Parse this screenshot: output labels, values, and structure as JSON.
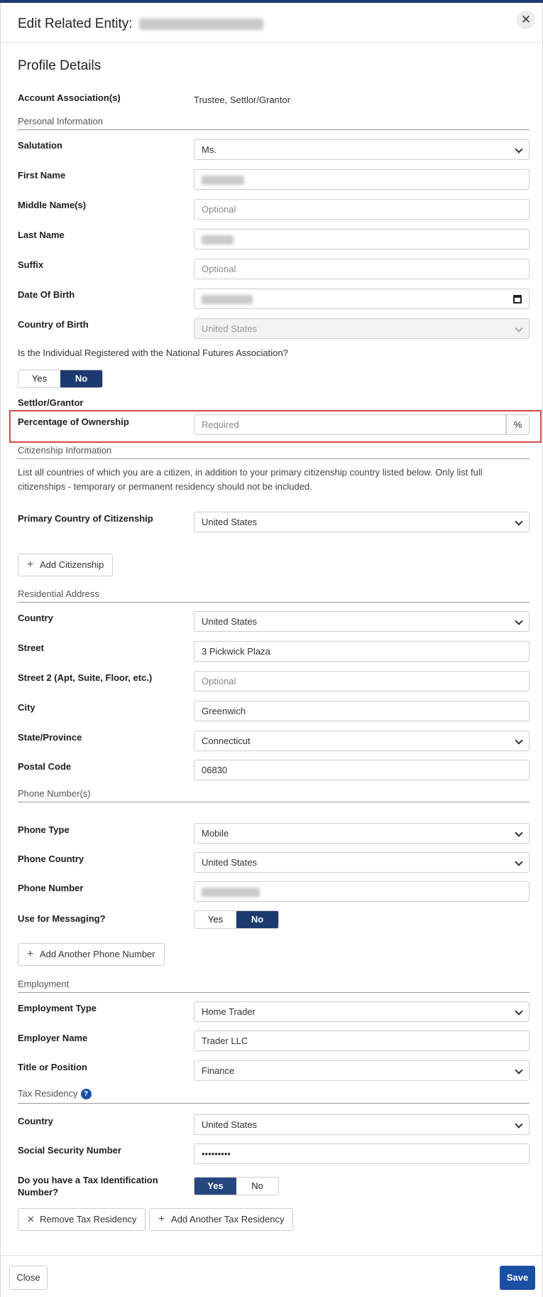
{
  "header": {
    "title": "Edit Related Entity:"
  },
  "profile": {
    "title": "Profile Details",
    "account_label": "Account Association(s)",
    "account_value": "Trustee, Settlor/Grantor"
  },
  "personal": {
    "section": "Personal Information",
    "salutation_label": "Salutation",
    "salutation_value": "Ms.",
    "first_name_label": "First Name",
    "middle_label": "Middle Name(s)",
    "middle_placeholder": "Optional",
    "last_name_label": "Last Name",
    "suffix_label": "Suffix",
    "suffix_placeholder": "Optional",
    "dob_label": "Date Of Birth",
    "cob_label": "Country of Birth",
    "cob_value": "United States",
    "nfa_question": "Is the Individual Registered with the National Futures Association?",
    "nfa_yes": "Yes",
    "nfa_no": "No"
  },
  "settlor": {
    "section": "Settlor/Grantor",
    "ownership_label": "Percentage of Ownership",
    "ownership_placeholder": "Required",
    "ownership_unit": "%"
  },
  "citizenship": {
    "section": "Citizenship Information",
    "note": "List all countries of which you are a citizen, in addition to your primary citizenship country listed below. Only list full citizenships - temporary or permanent residency should not be included.",
    "primary_label": "Primary Country of Citizenship",
    "primary_value": "United States",
    "add_button": "Add Citizenship"
  },
  "address": {
    "section": "Residential Address",
    "country_label": "Country",
    "country_value": "United States",
    "street_label": "Street",
    "street_value": "3 Pickwick Plaza",
    "street2_label": "Street 2 (Apt, Suite, Floor, etc.)",
    "street2_placeholder": "Optional",
    "city_label": "City",
    "city_value": "Greenwich",
    "state_label": "State/Province",
    "state_value": "Connecticut",
    "postal_label": "Postal Code",
    "postal_value": "06830"
  },
  "phone": {
    "section": "Phone Number(s)",
    "type_label": "Phone Type",
    "type_value": "Mobile",
    "country_label": "Phone Country",
    "country_value": "United States",
    "number_label": "Phone Number",
    "messaging_label": "Use for Messaging?",
    "messaging_yes": "Yes",
    "messaging_no": "No",
    "add_button": "Add Another Phone Number"
  },
  "employment": {
    "section": "Employment",
    "type_label": "Employment Type",
    "type_value": "Home Trader",
    "employer_label": "Employer Name",
    "employer_value": "Trader LLC",
    "title_label": "Title or Position",
    "title_value": "Finance"
  },
  "tax": {
    "section": "Tax Residency",
    "help": "?",
    "country_label": "Country",
    "country_value": "United States",
    "ssn_label": "Social Security Number",
    "ssn_value": "•••••••••",
    "tin_label_1": "Do you have a Tax Identification",
    "tin_label_2": "Number?",
    "tin_yes": "Yes",
    "tin_no": "No",
    "remove_button": "Remove Tax Residency",
    "add_button": "Add Another Tax Residency"
  },
  "footer": {
    "close": "Close",
    "save": "Save"
  }
}
